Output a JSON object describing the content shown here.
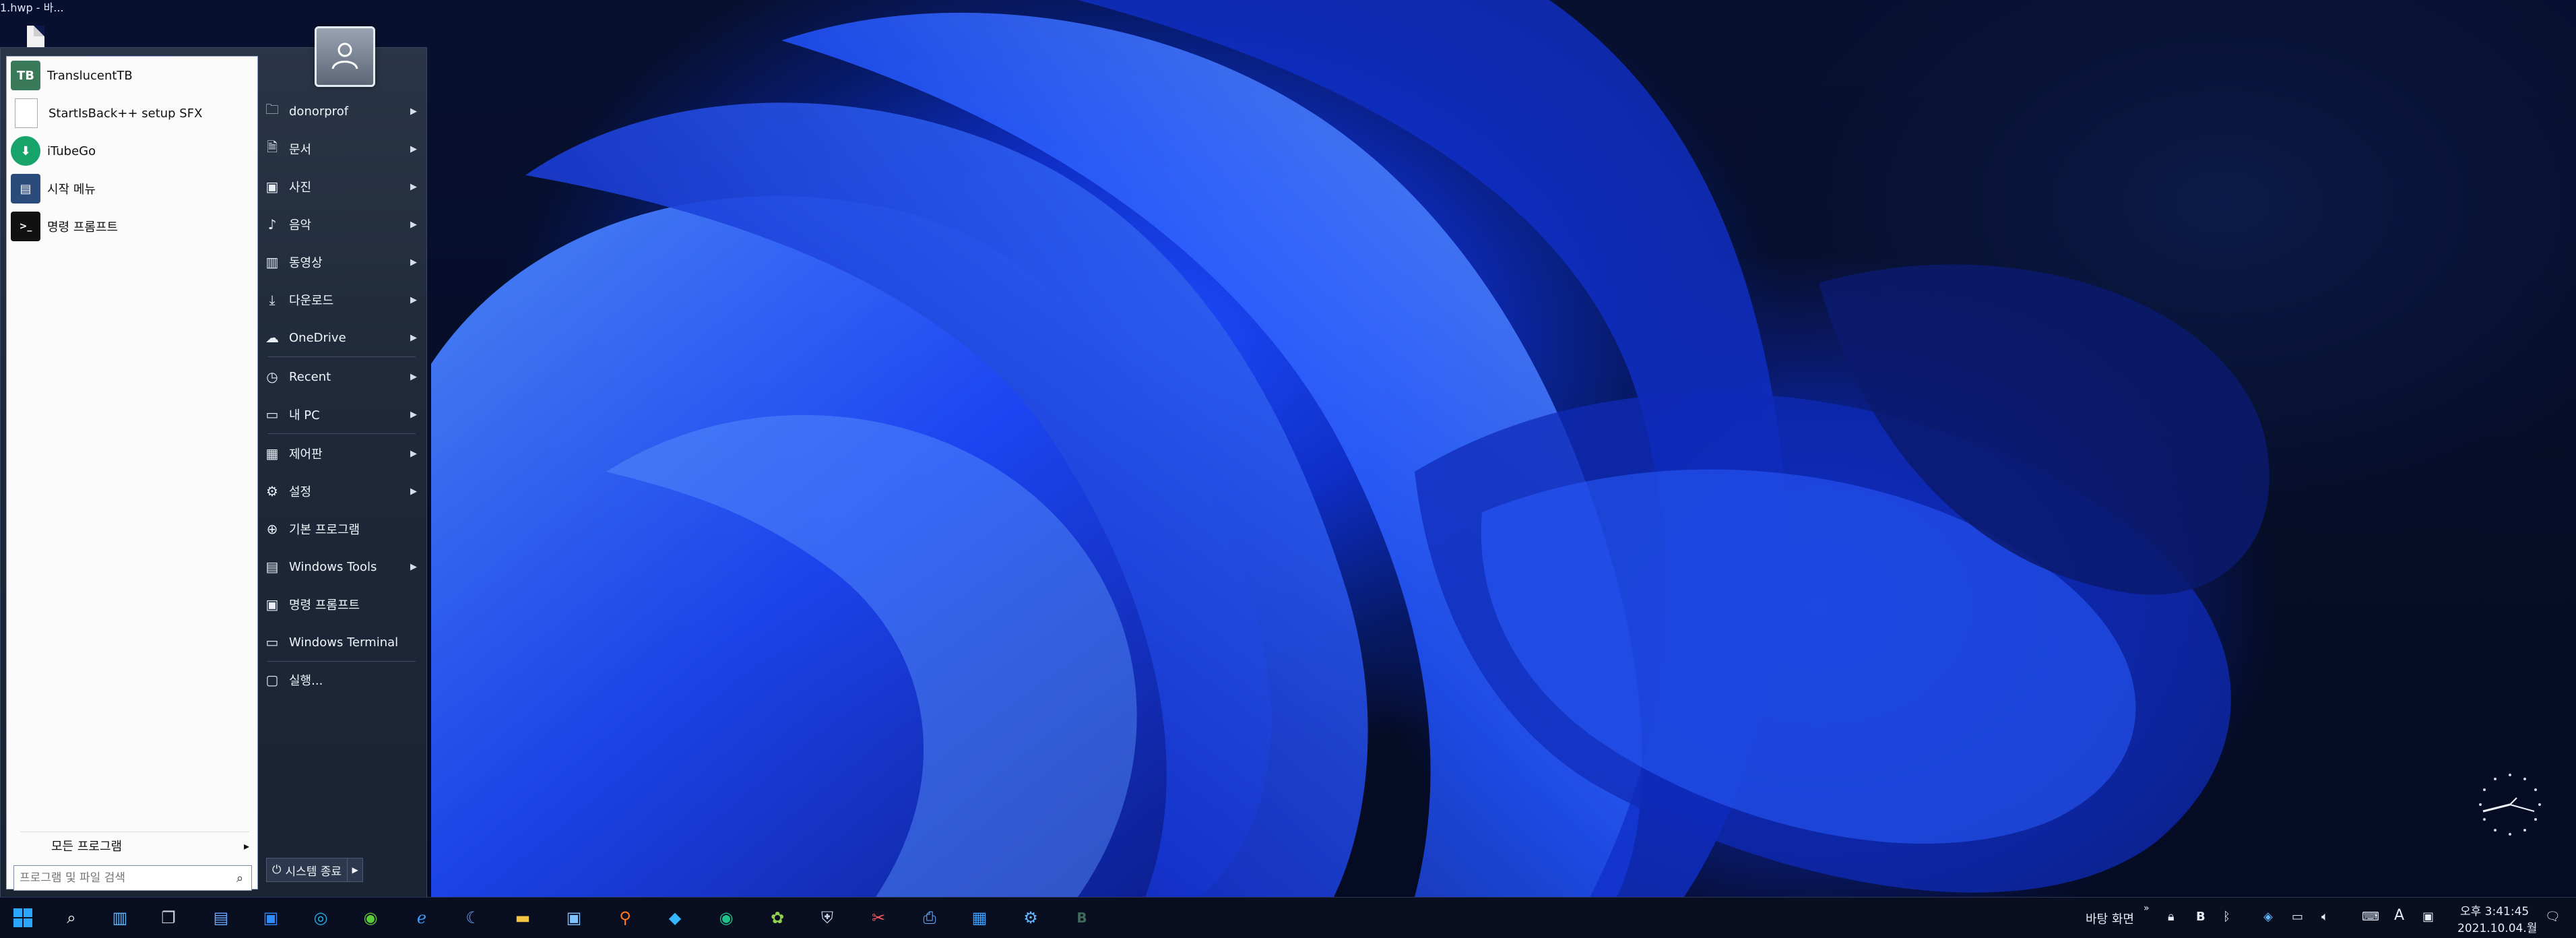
{
  "desktop": {
    "window_caption": "1.hwp - 바...",
    "wallpaper": "Windows 11 blue bloom"
  },
  "start_menu": {
    "programs": [
      {
        "label": "TranslucentTB",
        "icon": "translucenttb-icon"
      },
      {
        "label": "StartIsBack++ setup SFX",
        "icon": "file-icon"
      },
      {
        "label": "iTubeGo",
        "icon": "itubego-icon"
      },
      {
        "label": "시작 메뉴",
        "icon": "start-menu-icon"
      },
      {
        "label": "명령 프롬프트",
        "icon": "cmd-icon"
      }
    ],
    "all_programs": "모든 프로그램",
    "search_placeholder": "프로그램 및 파일 검색",
    "right_items": [
      {
        "label": "donorprof",
        "icon": "user-folder-icon",
        "submenu": true
      },
      {
        "label": "문서",
        "icon": "document-icon",
        "submenu": true
      },
      {
        "label": "사진",
        "icon": "picture-icon",
        "submenu": true
      },
      {
        "label": "음악",
        "icon": "music-icon",
        "submenu": true
      },
      {
        "label": "동영상",
        "icon": "video-icon",
        "submenu": true
      },
      {
        "label": "다운로드",
        "icon": "download-icon",
        "submenu": true
      },
      {
        "label": "OneDrive",
        "icon": "cloud-icon",
        "submenu": true
      },
      {
        "label": "Recent",
        "icon": "clock-icon",
        "submenu": true
      },
      {
        "label": "내 PC",
        "icon": "pc-icon",
        "submenu": true
      },
      {
        "label": "제어판",
        "icon": "control-panel-icon",
        "submenu": true
      },
      {
        "label": "설정",
        "icon": "gear-icon",
        "submenu": true
      },
      {
        "label": "기본 프로그램",
        "icon": "globe-icon",
        "submenu": false
      },
      {
        "label": "Windows Tools",
        "icon": "tools-icon",
        "submenu": true
      },
      {
        "label": "명령 프롬프트",
        "icon": "cmd-icon",
        "submenu": false
      },
      {
        "label": "Windows Terminal",
        "icon": "terminal-icon",
        "submenu": false
      },
      {
        "label": "실행...",
        "icon": "run-icon",
        "submenu": false
      }
    ],
    "shutdown_label": "시스템 종료"
  },
  "taskbar": {
    "desktop_label": "바탕 화면",
    "time": "오후 3:41:45",
    "date": "2021.10.04.월",
    "ime": "A"
  },
  "colors": {
    "accent": "#1f4cff",
    "menu_bg": "#1e2838",
    "taskbar_bg": "#0a1022"
  }
}
